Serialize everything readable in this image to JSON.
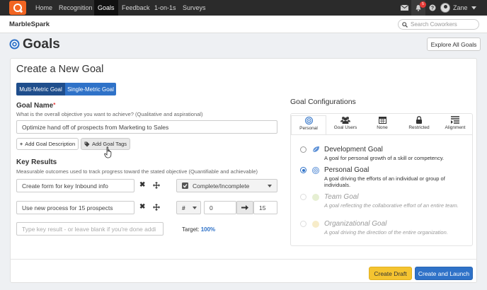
{
  "nav": {
    "items": [
      "Home",
      "Recognition",
      "Goals",
      "Feedback",
      "1-on-1s",
      "Surveys"
    ],
    "notification_count": "5",
    "user_name": "Zane"
  },
  "subheader": {
    "brand": "MarbleSpark",
    "search_placeholder": "Search Coworkers"
  },
  "page": {
    "title": "Goals",
    "explore_button": "Explore All Goals"
  },
  "form": {
    "title": "Create a New Goal",
    "goal_type_options": [
      "Multi-Metric Goal",
      "Single-Metric Goal"
    ],
    "goal_name_label": "Goal Name",
    "required_mark": "*",
    "goal_name_hint": "What is the overall objective you want to achieve? (Qualitative and aspirational)",
    "goal_name_value": "Optimize hand off of prospects from Marketing to Sales",
    "add_description_button": "Add Goal Description",
    "add_tags_button": "Add Goal Tags",
    "key_results_label": "Key Results",
    "key_results_hint": "Measurable outcomes used to track progress toward the stated objective (Quantifiable and achievable)",
    "key_results": [
      {
        "text": "Create form for key Inbound info",
        "metric": "Complete/Incomplete"
      },
      {
        "text": "Use new process for 15 prospects",
        "metric_symbol": "#",
        "start": "0",
        "target": "15"
      }
    ],
    "new_key_result_placeholder": "Type key result - or leave blank if you're done addi",
    "target_label": "Target:",
    "target_value": "100%"
  },
  "config": {
    "title": "Goal Configurations",
    "tabs": [
      {
        "label": "Personal",
        "icon": "target-icon"
      },
      {
        "label": "Goal Users",
        "icon": "users-icon"
      },
      {
        "label": "None",
        "icon": "calendar-icon"
      },
      {
        "label": "Restricted",
        "icon": "lock-icon"
      },
      {
        "label": "Alignment",
        "icon": "list-icon"
      }
    ],
    "options": [
      {
        "title": "Development Goal",
        "desc": "A goal for personal growth of a skill or competency.",
        "state": "enabled",
        "selected": false
      },
      {
        "title": "Personal Goal",
        "desc": "A goal driving the efforts of an individual or group of individuals.",
        "state": "enabled",
        "selected": true
      },
      {
        "title": "Team Goal",
        "desc": "A goal reflecting the collaborative effort of an entire team.",
        "state": "disabled",
        "selected": false
      },
      {
        "title": "Organizational Goal",
        "desc": "A goal driving the direction of the entire organization.",
        "state": "disabled",
        "selected": false
      }
    ]
  },
  "footer": {
    "create_draft_button": "Create Draft",
    "create_launch_button": "Create and Launch"
  },
  "colors": {
    "brand_orange": "#f26522",
    "primary_blue": "#2f72c8",
    "dark_blue": "#1f4e8c",
    "draft_yellow": "#f5c430",
    "nav_bg": "#2b2b2b"
  }
}
